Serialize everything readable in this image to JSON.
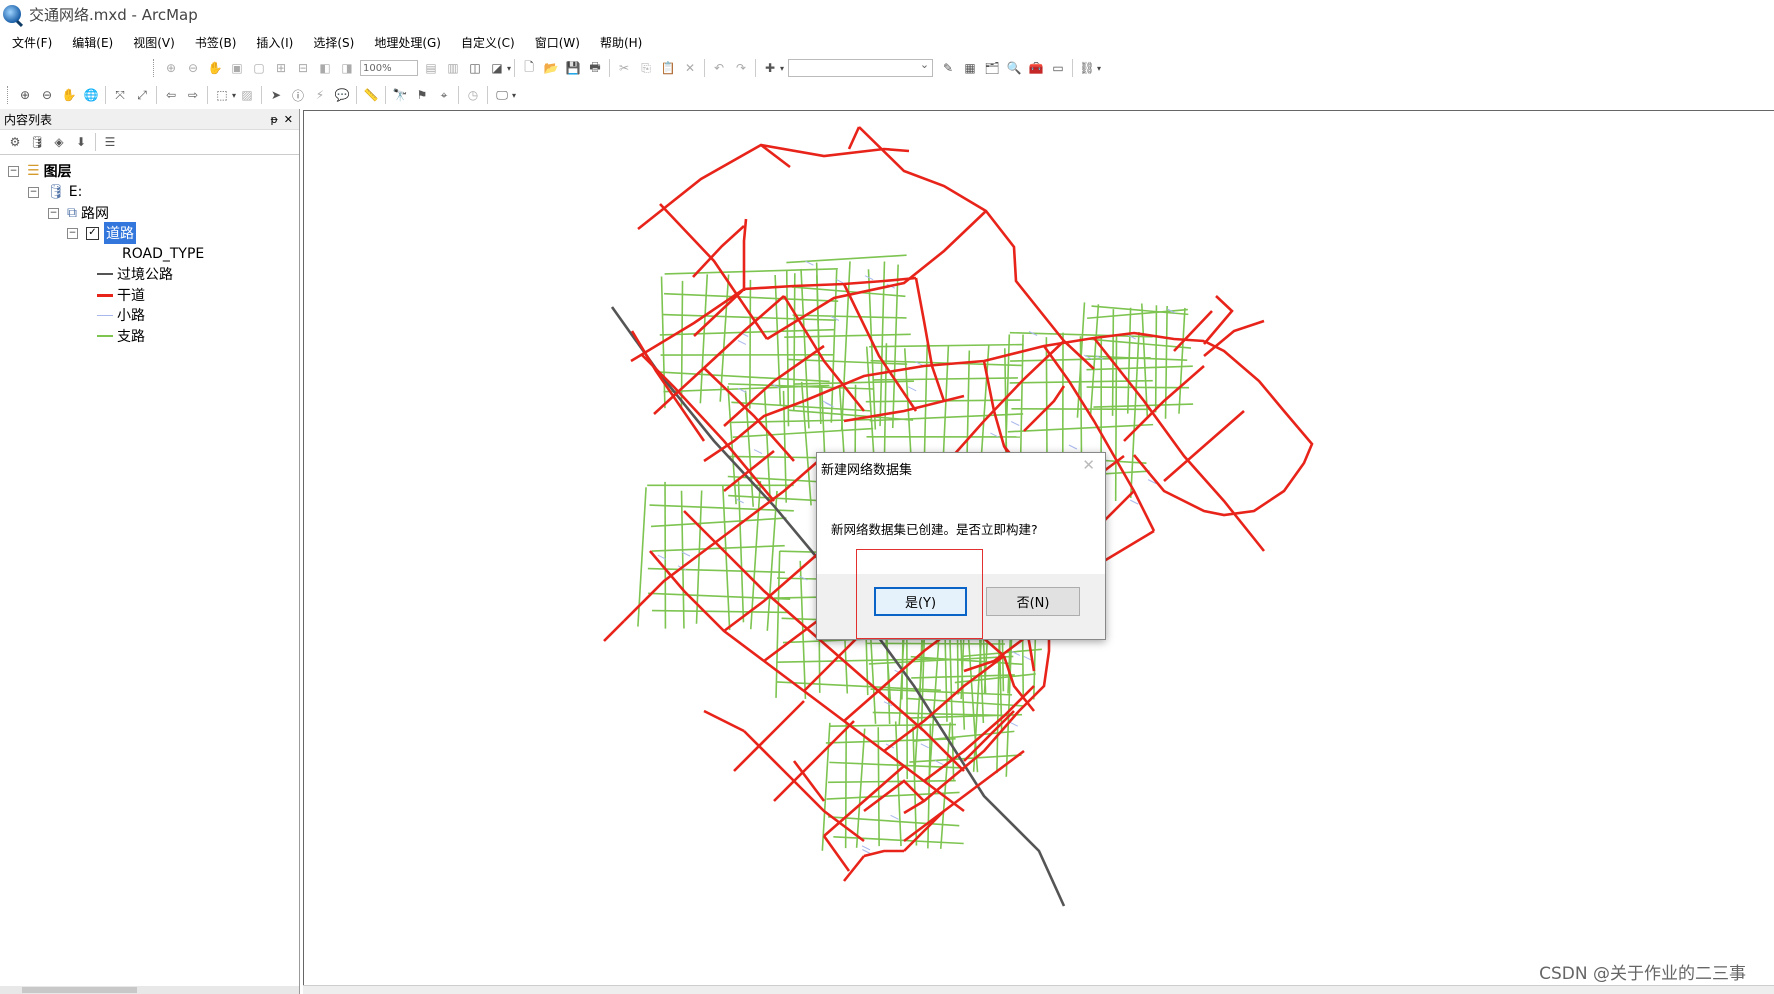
{
  "window": {
    "title": "交通网络.mxd - ArcMap"
  },
  "menu": [
    "文件(F)",
    "编辑(E)",
    "视图(V)",
    "书签(B)",
    "插入(I)",
    "选择(S)",
    "地理处理(G)",
    "自定义(C)",
    "窗口(W)",
    "帮助(H)"
  ],
  "toolbar": {
    "zoom_value": "100%"
  },
  "toc": {
    "title": "内容列表",
    "pin_glyph": "ᵽ",
    "close_glyph": "✕",
    "root": "图层",
    "drive": "E:",
    "dataset": "路网",
    "layer": "道路",
    "field": "ROAD_TYPE",
    "legend": [
      {
        "label": "过境公路",
        "color": "#555555"
      },
      {
        "label": "干道",
        "color": "#e8231a"
      },
      {
        "label": "小路",
        "color": "#a8b8ec"
      },
      {
        "label": "支路",
        "color": "#7dc451"
      }
    ]
  },
  "dialog": {
    "title": "新建网络数据集",
    "message": "新网络数据集已创建。是否立即构建?",
    "yes": "是(Y)",
    "no": "否(N)",
    "close_glyph": "✕"
  },
  "watermark": "CSDN @关于作业的二三事",
  "colors": {
    "highway": "#555555",
    "arterial": "#e8231a",
    "lane": "#a8b8ec",
    "branch": "#7dc451",
    "selection": "#3377dd",
    "dialog_focus": "#0a64c8",
    "annotation": "#e23030"
  }
}
